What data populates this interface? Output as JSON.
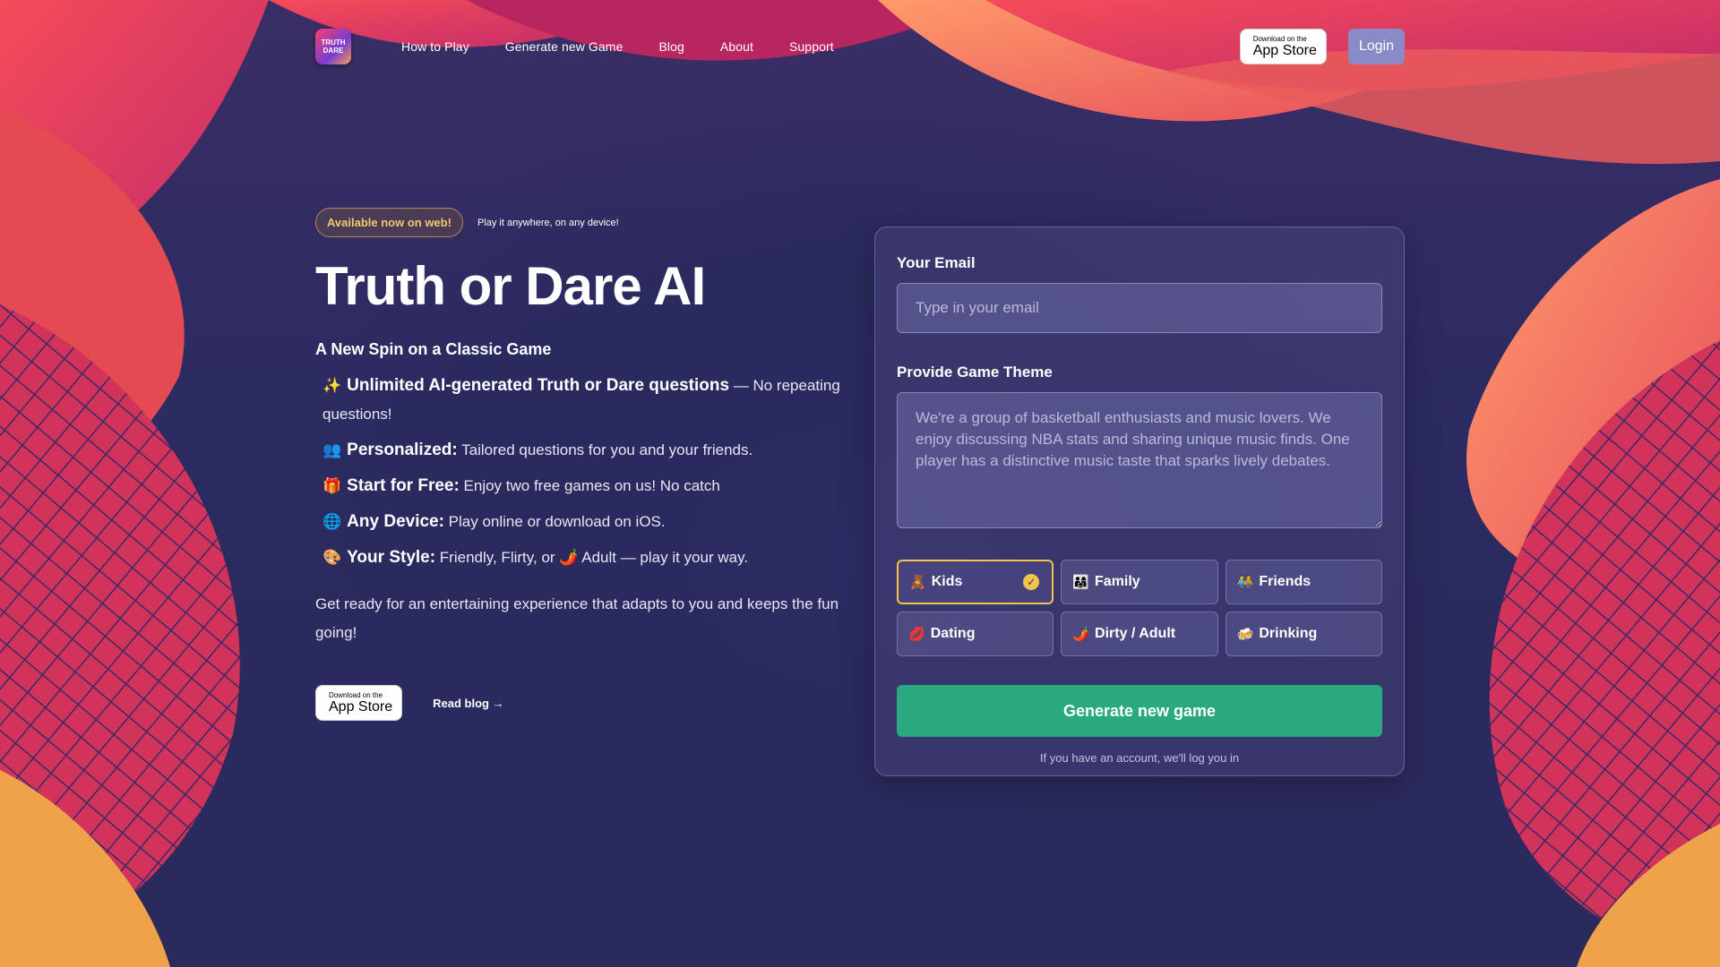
{
  "header": {
    "logo_line1": "TRUTH",
    "logo_line2": "DARE",
    "nav": [
      "How to Play",
      "Generate new Game",
      "Blog",
      "About",
      "Support"
    ],
    "appstore_small": "Download on the",
    "appstore_big": "App Store",
    "login_label": "Login"
  },
  "hero": {
    "badge": "Available now on web!",
    "badge_note": "Play it anywhere, on any device!",
    "title": "Truth or Dare AI",
    "subtitle": "A New Spin on a Classic Game",
    "features": [
      {
        "icon": "✨",
        "strong": "Unlimited AI-generated Truth or Dare questions",
        "text": " — No repeating questions!"
      },
      {
        "icon": "👥",
        "strong": "Personalized:",
        "text": " Tailored questions for you and your friends."
      },
      {
        "icon": "🎁",
        "strong": "Start for Free:",
        "text": " Enjoy two free games on us! No catch"
      },
      {
        "icon": "🌐",
        "strong": "Any Device:",
        "text": " Play online or download on iOS."
      },
      {
        "icon": "🎨",
        "strong": "Your Style:",
        "text": " Friendly, Flirty, or 🌶️ Adult — play it your way."
      }
    ],
    "intro": "Get ready for an entertaining experience that adapts to you and keeps the fun going!",
    "appstore_small": "Download on the",
    "appstore_big": "App Store",
    "read_blog": "Read blog →"
  },
  "form": {
    "email_label": "Your Email",
    "email_placeholder": "Type in your email",
    "theme_label": "Provide Game Theme",
    "theme_placeholder": "We're a group of basketball enthusiasts and music lovers. We enjoy discussing NBA stats and sharing unique music finds. One player has a distinctive music taste that sparks lively debates.",
    "categories": [
      {
        "emoji": "🧸",
        "label": "Kids",
        "selected": true
      },
      {
        "emoji": "👨‍👩‍👧",
        "label": "Family",
        "selected": false
      },
      {
        "emoji": "🧑‍🤝‍🧑",
        "label": "Friends",
        "selected": false
      },
      {
        "emoji": "💋",
        "label": "Dating",
        "selected": false
      },
      {
        "emoji": "🌶️",
        "label": "Dirty / Adult",
        "selected": false
      },
      {
        "emoji": "🍻",
        "label": "Drinking",
        "selected": false
      }
    ],
    "generate_label": "Generate new game",
    "note": "If you have an account, we'll log you in"
  },
  "colors": {
    "accent_green": "#2aa981",
    "badge_gold": "#f2c86a",
    "background": "#2a2a5e"
  }
}
